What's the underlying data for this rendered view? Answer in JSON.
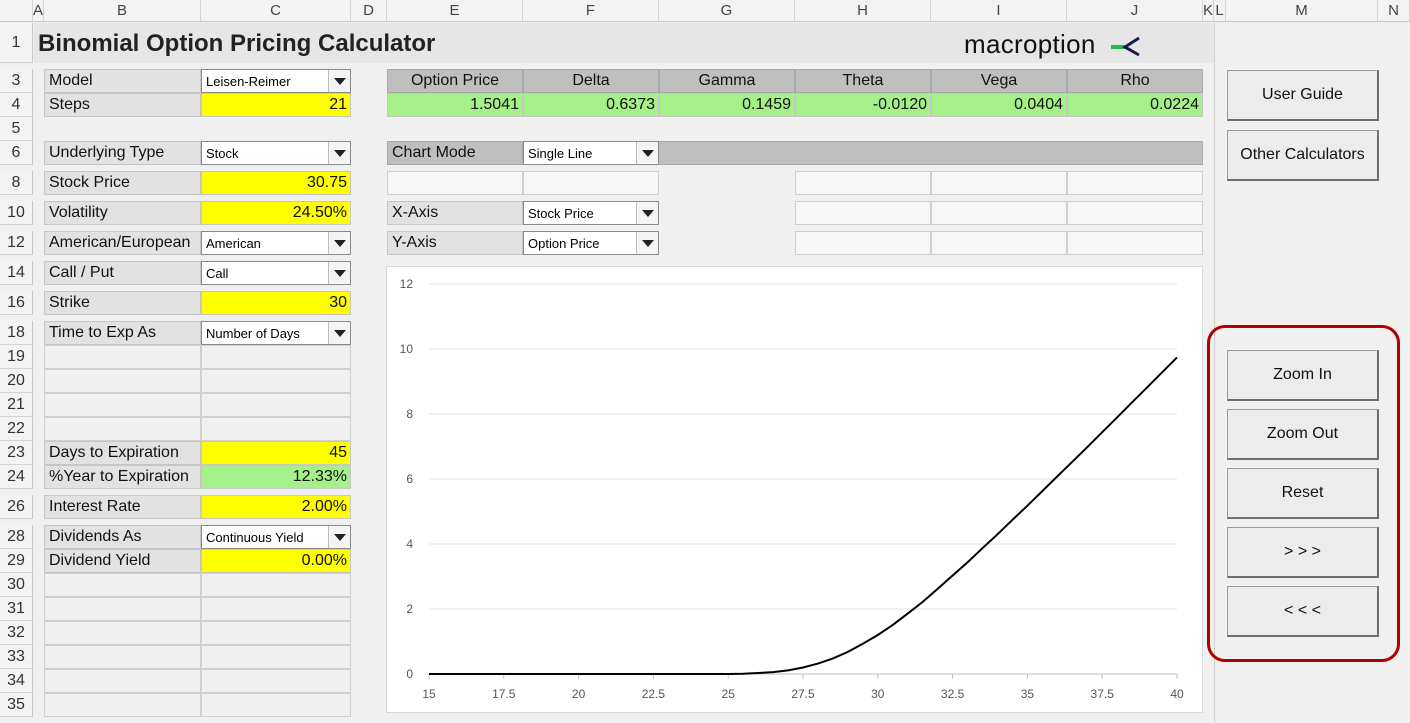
{
  "columns": [
    "A",
    "B",
    "C",
    "D",
    "E",
    "F",
    "G",
    "H",
    "I",
    "J",
    "K",
    "L",
    "M",
    "N"
  ],
  "rows": [
    "1",
    "3",
    "4",
    "5",
    "6",
    "8",
    "10",
    "12",
    "14",
    "16",
    "18",
    "19",
    "20",
    "21",
    "22",
    "23",
    "24",
    "26",
    "28",
    "29",
    "30",
    "31",
    "32",
    "33",
    "34",
    "35"
  ],
  "title": "Binomial Option Pricing Calculator",
  "logo": {
    "text": "macroption",
    "accent": "#2db84d",
    "accent2": "#1a1a4a"
  },
  "inputs": {
    "model_label": "Model",
    "model_value": "Leisen-Reimer",
    "steps_label": "Steps",
    "steps_value": "21",
    "underlying_label": "Underlying Type",
    "underlying_value": "Stock",
    "price_label": "Stock Price",
    "price_value": "30.75",
    "vol_label": "Volatility",
    "vol_value": "24.50%",
    "style_label": "American/European",
    "style_value": "American",
    "cp_label": "Call / Put",
    "cp_value": "Call",
    "strike_label": "Strike",
    "strike_value": "30",
    "tte_label": "Time to Exp As",
    "tte_value": "Number of Days",
    "days_label": "Days to Expiration",
    "days_value": "45",
    "year_label": "%Year to Expiration",
    "year_value": "12.33%",
    "rate_label": "Interest Rate",
    "rate_value": "2.00%",
    "div_as_label": "Dividends As",
    "div_as_value": "Continuous Yield",
    "div_label": "Dividend Yield",
    "div_value": "0.00%"
  },
  "results": {
    "headers": [
      "Option Price",
      "Delta",
      "Gamma",
      "Theta",
      "Vega",
      "Rho"
    ],
    "values": [
      "1.5041",
      "0.6373",
      "0.1459",
      "-0.0120",
      "0.0404",
      "0.0224"
    ]
  },
  "chart_controls": {
    "mode_label": "Chart Mode",
    "mode_value": "Single Line",
    "x_label": "X-Axis",
    "x_value": "Stock Price",
    "y_label": "Y-Axis",
    "y_value": "Option Price"
  },
  "buttons": {
    "user_guide": "User Guide",
    "other_calcs": "Other Calculators",
    "zoom_in": "Zoom In",
    "zoom_out": "Zoom Out",
    "reset": "Reset",
    "forward": "> > >",
    "back": "< < <"
  },
  "chart_data": {
    "type": "line",
    "xlim": [
      15,
      40
    ],
    "ylim": [
      0,
      12
    ],
    "xticks": [
      "15",
      "17.5",
      "20",
      "22.5",
      "25",
      "27.5",
      "30",
      "32.5",
      "35",
      "37.5",
      "40"
    ],
    "yticks": [
      "0",
      "2",
      "4",
      "6",
      "8",
      "10",
      "12"
    ],
    "grid": true,
    "x": [
      15,
      20,
      25,
      25.5,
      26,
      26.5,
      27,
      27.5,
      28,
      28.5,
      29,
      29.5,
      30,
      30.5,
      31,
      31.5,
      32,
      32.5,
      33,
      33.5,
      34,
      34.5,
      35,
      35.5,
      36,
      36.5,
      37,
      37.5,
      38,
      38.5,
      39,
      39.5,
      40
    ],
    "y": [
      0,
      0,
      0,
      0.01,
      0.03,
      0.06,
      0.11,
      0.2,
      0.32,
      0.48,
      0.68,
      0.93,
      1.2,
      1.51,
      1.86,
      2.22,
      2.62,
      3.03,
      3.44,
      3.87,
      4.3,
      4.74,
      5.18,
      5.63,
      6.08,
      6.53,
      6.98,
      7.44,
      7.9,
      8.36,
      8.82,
      9.28,
      9.74
    ]
  }
}
